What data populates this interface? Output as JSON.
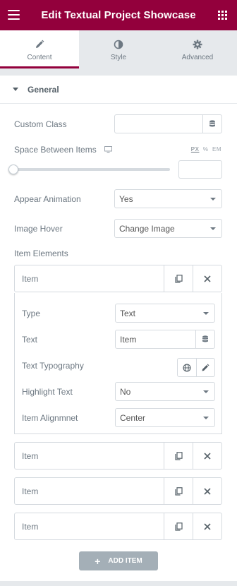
{
  "header": {
    "title": "Edit Textual Project Showcase",
    "menu_icon": "hamburger-icon",
    "grid_icon": "grid-icon"
  },
  "tabs": [
    {
      "label": "Content",
      "icon": "pencil-icon",
      "active": true
    },
    {
      "label": "Style",
      "icon": "half-circle-icon",
      "active": false
    },
    {
      "label": "Advanced",
      "icon": "gear-icon",
      "active": false
    }
  ],
  "section": {
    "title": "General"
  },
  "controls": {
    "custom_class": {
      "label": "Custom Class",
      "value": ""
    },
    "space_between": {
      "label": "Space Between Items",
      "units": [
        "PX",
        "%",
        "EM"
      ],
      "active_unit": "PX",
      "value": ""
    },
    "appear_animation": {
      "label": "Appear Animation",
      "value": "Yes"
    },
    "image_hover": {
      "label": "Image Hover",
      "value": "Change Image"
    },
    "item_elements": {
      "label": "Item Elements"
    }
  },
  "items": [
    {
      "title": "Item"
    },
    {
      "title": "Item"
    },
    {
      "title": "Item"
    },
    {
      "title": "Item"
    }
  ],
  "expanded_item": {
    "type": {
      "label": "Type",
      "value": "Text"
    },
    "text": {
      "label": "Text",
      "value": "Item"
    },
    "text_typography": {
      "label": "Text Typography"
    },
    "highlight_text": {
      "label": "Highlight Text",
      "value": "No"
    },
    "item_alignment": {
      "label": "Item Alignmnet",
      "value": "Center"
    }
  },
  "add_item": {
    "label": "ADD ITEM"
  },
  "colors": {
    "accent": "#93003c",
    "panel_bg": "#e6e9ec",
    "button_gray": "#a4afb7"
  }
}
